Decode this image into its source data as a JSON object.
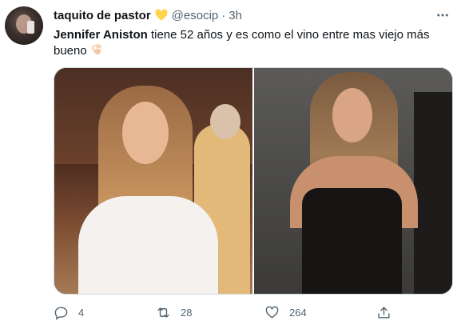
{
  "author": {
    "name": "taquito de pastor",
    "handle": "@esocip",
    "separator": "·",
    "time": "3h"
  },
  "tweet": {
    "mention": "Jennifer Aniston",
    "text": " tiene 52 años y es como el vino entre mas viejo más bueno"
  },
  "stats": {
    "replies": "4",
    "retweets": "28",
    "likes": "264"
  },
  "colors": {
    "heart_emoji": "#ffd54f",
    "icon_gray": "#536471",
    "border": "#cfd9de"
  },
  "icons": [
    "yellow-heart-emoji",
    "more-icon",
    "ok-hand-emoji",
    "reply-icon",
    "retweet-icon",
    "like-icon",
    "share-icon"
  ]
}
